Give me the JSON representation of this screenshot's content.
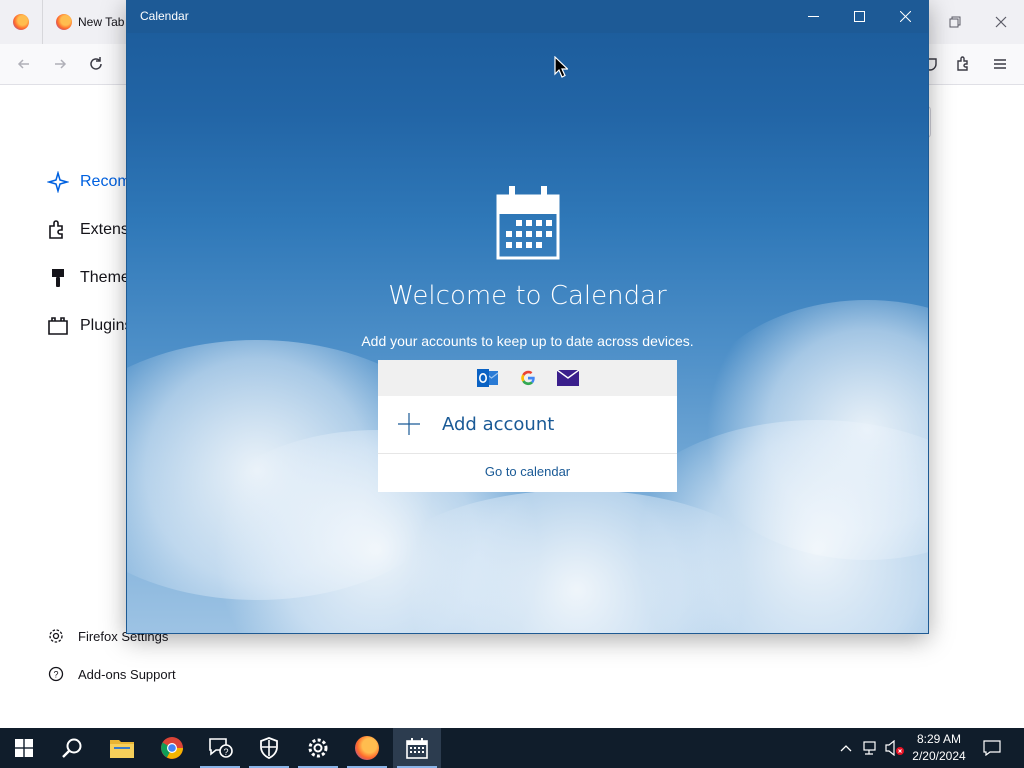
{
  "firefox": {
    "tabs": [
      {
        "label": "New Tab"
      }
    ],
    "sidebar": [
      {
        "label": "Recom",
        "icon": "sparkle-icon"
      },
      {
        "label": "Extensi",
        "icon": "puzzle-icon"
      },
      {
        "label": "Theme",
        "icon": "brush-icon"
      },
      {
        "label": "Plugins",
        "icon": "folder-icon"
      }
    ],
    "footer": {
      "settings": "Firefox Settings",
      "support": "Add-ons Support"
    }
  },
  "calendar": {
    "window_title": "Calendar",
    "welcome": "Welcome to Calendar",
    "subtitle": "Add your accounts to keep up to date across devices.",
    "providers": [
      "outlook-icon",
      "google-icon",
      "mail-icon"
    ],
    "add_account": "Add account",
    "go_to_calendar": "Go to calendar"
  },
  "taskbar": {
    "apps": [
      "start",
      "search",
      "file-explorer",
      "chrome",
      "feedback-hub",
      "security",
      "settings",
      "firefox",
      "calendar"
    ],
    "active_app": "calendar",
    "time": "8:29 AM",
    "date": "2/20/2024"
  },
  "colors": {
    "titlebar": "#1d5a96",
    "accent": "#1a5a96",
    "taskbar": "#101d2b",
    "firefox_accent": "#0061e0"
  }
}
